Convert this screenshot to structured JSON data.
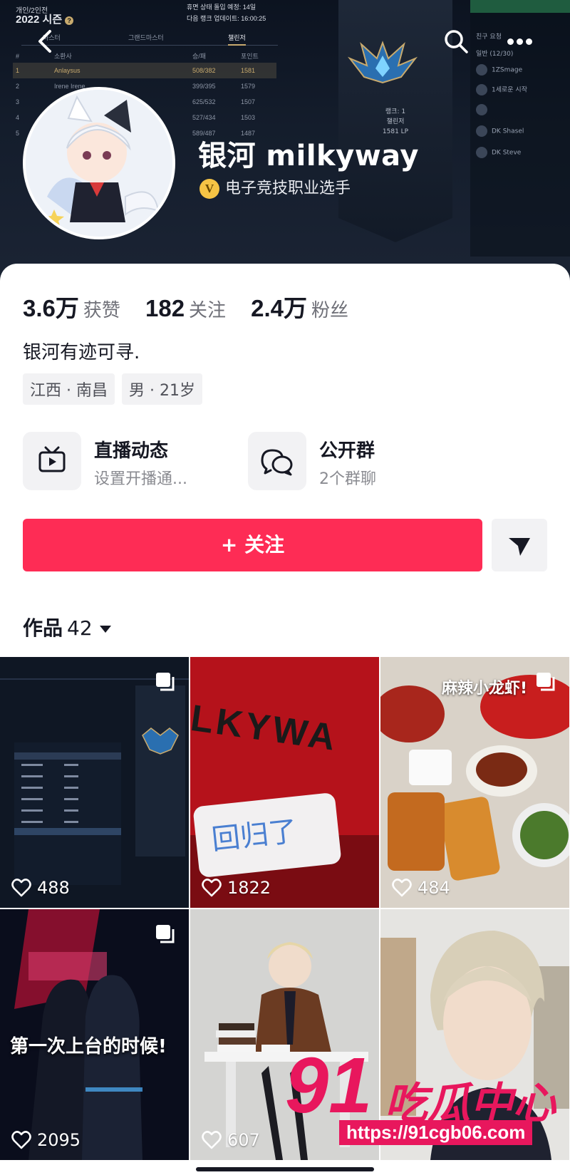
{
  "cover": {
    "season_line1": "개인/2인전",
    "season_line2": "2022 시즌",
    "rank_note_1": "휴면 상태 돌입 예정: 14일",
    "rank_note_2": "다음 랭크 업데이트: 16:00:25",
    "tabs": [
      "마스터",
      "그랜드마스터",
      "챌린저"
    ],
    "col_headers": [
      "#",
      "소환사",
      "승/패",
      "포인트"
    ],
    "rows": [
      {
        "rank": "1",
        "name": "Anlaysus",
        "wl": "508/382",
        "pts": "1581"
      },
      {
        "rank": "2",
        "name": "Irene Irene",
        "wl": "399/395",
        "pts": "1579"
      },
      {
        "rank": "3",
        "name": "",
        "wl": "625/532",
        "pts": "1507"
      },
      {
        "rank": "4",
        "name": "",
        "wl": "527/434",
        "pts": "1503"
      },
      {
        "rank": "5",
        "name": "",
        "wl": "589/487",
        "pts": "1487"
      }
    ],
    "banner_line1": "랭크: 1",
    "banner_line2": "챌린저",
    "banner_line3": "1581 LP",
    "friends_header": "친구 요청",
    "friends_group": "일반 (12/30)",
    "friends": [
      "1ZSmage",
      "1세로운 시작",
      "",
      "DK Shasel",
      "DK Steve"
    ]
  },
  "header": {
    "back_icon": "chevron-left-icon",
    "search_icon": "search-icon",
    "more_icon": "more-dots-icon"
  },
  "profile": {
    "name": "银河 milkyway",
    "verify_badge": "V",
    "verify_text": "电子竞技职业选手",
    "stats": [
      {
        "num": "3.6万",
        "label": "获赞"
      },
      {
        "num": "182",
        "label": "关注"
      },
      {
        "num": "2.4万",
        "label": "粉丝"
      }
    ],
    "bio": "银河有迹可寻.",
    "tags": [
      "江西 · 南昌",
      "男 · 21岁"
    ],
    "features": [
      {
        "icon": "tv-play-icon",
        "title": "直播动态",
        "sub": "设置开播通..."
      },
      {
        "icon": "chat-bubbles-icon",
        "title": "公开群",
        "sub": "2个群聊"
      }
    ],
    "follow_label": "+ 关注",
    "works_label": "作品",
    "works_count": "42"
  },
  "grid": [
    {
      "likes": "488",
      "multi": true,
      "caption": ""
    },
    {
      "likes": "1822",
      "multi": false,
      "caption": "LKYWA"
    },
    {
      "likes": "484",
      "multi": true,
      "caption": "麻辣小龙虾!"
    },
    {
      "likes": "2095",
      "multi": true,
      "caption": "第一次上台的时候!"
    },
    {
      "likes": "607",
      "multi": false,
      "caption": ""
    },
    {
      "likes": "",
      "multi": false,
      "caption": ""
    }
  ],
  "watermark": {
    "brand_num": "91",
    "brand_cn": "吃瓜中心",
    "url": "https://91cgb06.com"
  },
  "colors": {
    "accent": "#fe2c55",
    "text_primary": "#161823",
    "text_secondary": "#8a8b91",
    "chip_bg": "#f2f2f4",
    "cover_bg": "#141d2c",
    "gold": "#c8aa6e",
    "watermark": "#e8175d"
  }
}
